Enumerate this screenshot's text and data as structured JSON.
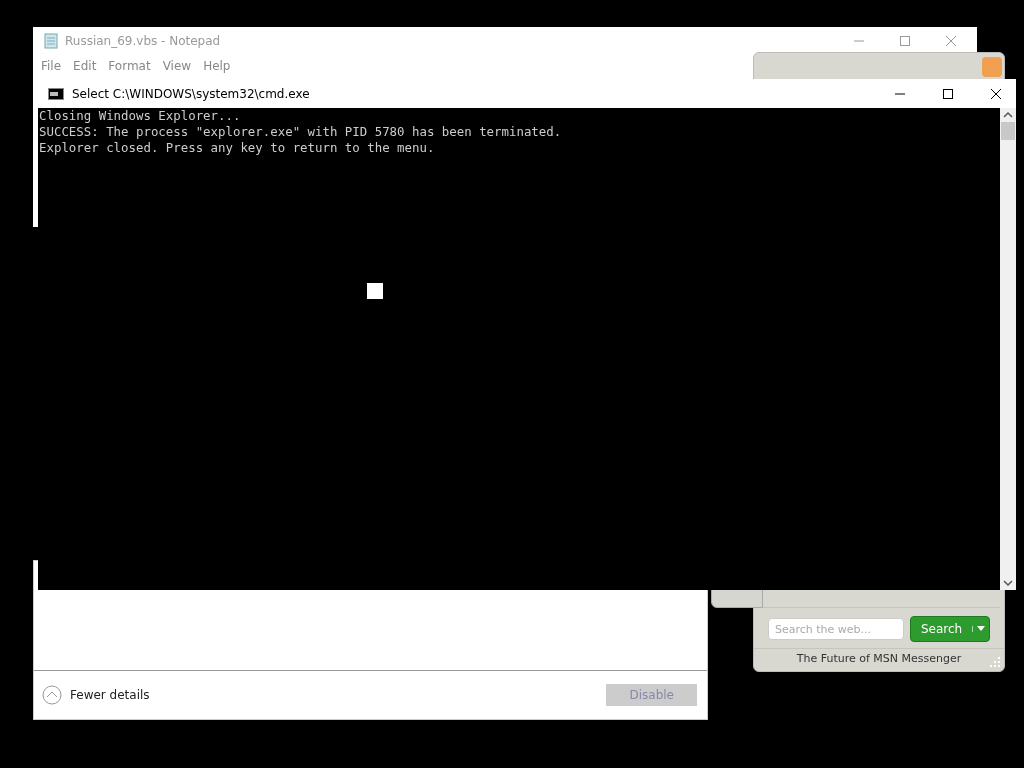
{
  "notepad": {
    "title": "Russian_69.vbs - Notepad",
    "menu": [
      "File",
      "Edit",
      "Format",
      "View",
      "Help"
    ]
  },
  "startup_list": {
    "details_toggle": "Fewer details",
    "action_button": {
      "label": "Disable",
      "disabled": true
    }
  },
  "messenger": {
    "search": {
      "placeholder": "Search the web..."
    },
    "search_button": "Search",
    "footer": "The Future of MSN Messenger"
  },
  "console": {
    "title": "Select C:\\WINDOWS\\system32\\cmd.exe",
    "lines": [
      "Closing Windows Explorer...",
      "SUCCESS: The process \"explorer.exe\" with PID 5780 has been terminated.",
      "Explorer closed. Press any key to return to the menu."
    ]
  }
}
